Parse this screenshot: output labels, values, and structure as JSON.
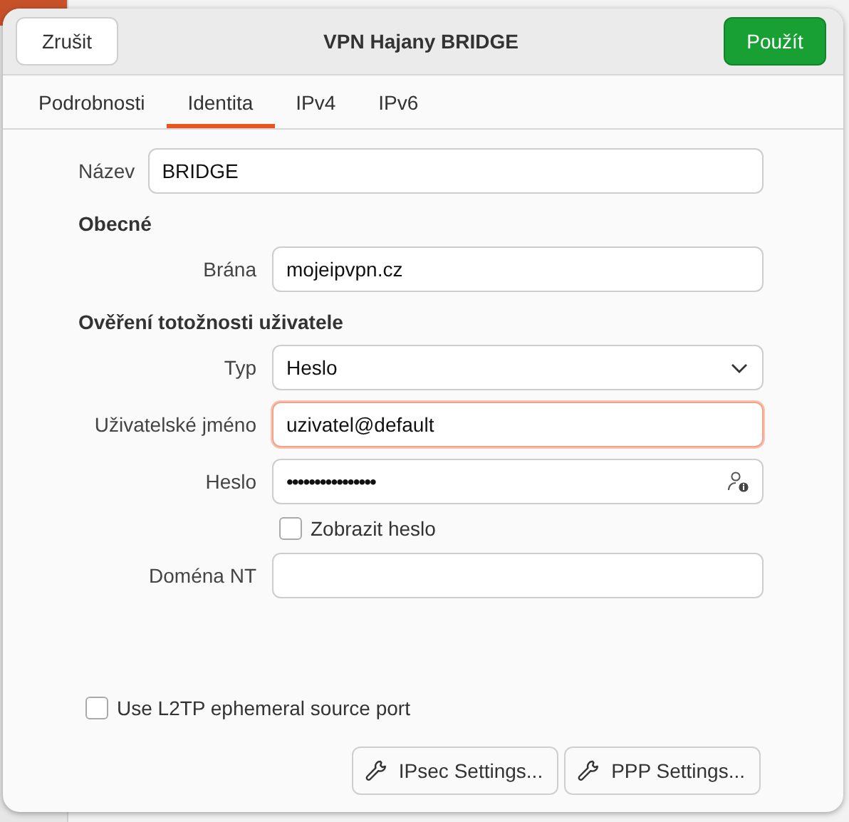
{
  "dialog": {
    "title": "VPN Hajany BRIDGE",
    "cancel_button": "Zrušit",
    "apply_button": "Použít"
  },
  "tabs": [
    {
      "label": "Podrobnosti",
      "selected": false
    },
    {
      "label": "Identita",
      "selected": true
    },
    {
      "label": "IPv4",
      "selected": false
    },
    {
      "label": "IPv6",
      "selected": false
    }
  ],
  "name_field": {
    "label": "Název",
    "value": "BRIDGE"
  },
  "sections": [
    {
      "heading": "Obecné",
      "rows": [
        {
          "kind": "text",
          "label": "Brána",
          "value": "mojeipvpn.cz",
          "focused": false
        }
      ]
    },
    {
      "heading": "Ověření totožnosti uživatele",
      "rows": [
        {
          "kind": "dropdown",
          "label": "Typ",
          "value": "Heslo"
        },
        {
          "kind": "text",
          "label": "Uživatelské jméno",
          "value": "uzivatel@default",
          "focused": true
        },
        {
          "kind": "password",
          "label": "Heslo",
          "value": "••••••••••••••••",
          "show_password": {
            "label": "Zobrazit heslo",
            "checked": false
          }
        },
        {
          "kind": "text",
          "label": "Doména NT",
          "focused": false
        }
      ]
    }
  ],
  "l2tp_checkbox": {
    "label": "Use L2TP ephemeral source port",
    "checked": false
  },
  "footer_buttons": [
    {
      "label": "IPsec Settings..."
    },
    {
      "label": "PPP Settings..."
    }
  ]
}
